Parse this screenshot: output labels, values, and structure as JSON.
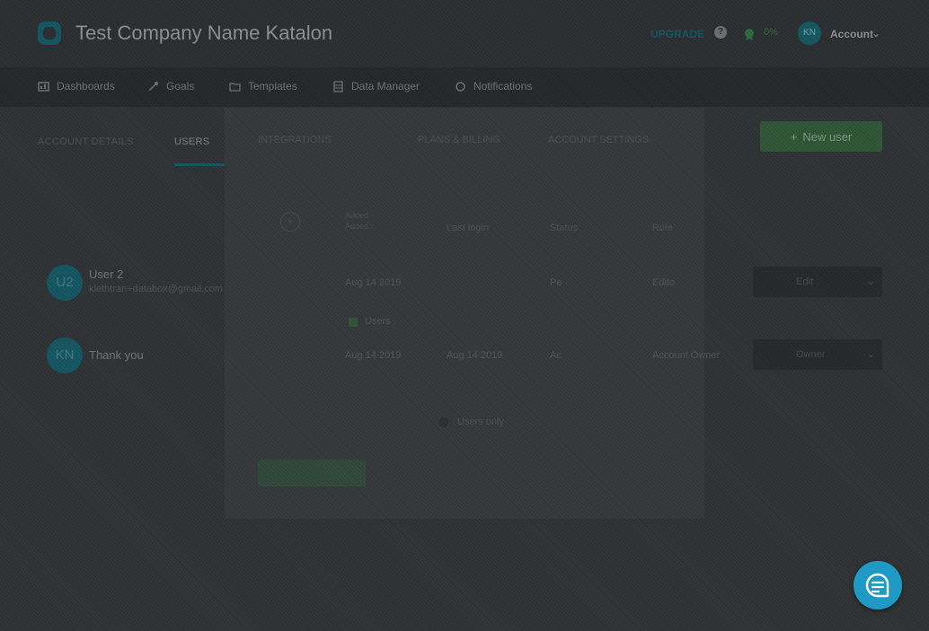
{
  "header": {
    "company": "Test Company Name Katalon",
    "upgrade": "UPGRADE",
    "badge_count": "0%",
    "avatar_initials": "KN",
    "account": "Account"
  },
  "nav": [
    {
      "label": "Dashboards",
      "icon": "dashboard-icon"
    },
    {
      "label": "Goals",
      "icon": "goals-icon"
    },
    {
      "label": "Templates",
      "icon": "folder-icon"
    },
    {
      "label": "Data Manager",
      "icon": "database-icon"
    },
    {
      "label": "Notifications",
      "icon": "bell-icon"
    }
  ],
  "tabs": {
    "account_details": "ACCOUNT DETAILS",
    "users": "USERS",
    "integrations": "INTEGRATIONS",
    "plans_billing": "PLANS & BILLING",
    "account_settings": "ACCOUNT SETTINGS"
  },
  "new_user": "New user",
  "table_headers": {
    "added": "Added",
    "last_login": "Last login",
    "status": "Status",
    "role": "Role",
    "mini_header": [
      "Added",
      "Added ↑"
    ]
  },
  "users": [
    {
      "initials": "U2",
      "name": "User 2",
      "email": "kiethtran+databox@gmail.com",
      "added": "Aug 14 2019",
      "status": "Pe",
      "role": "Edito",
      "select": "Edit"
    },
    {
      "initials": "KN",
      "name": "Thank you",
      "email": "",
      "added": "Aug 14 2019",
      "last_login": "Aug 14 2019",
      "status": "Ac",
      "role": "Account Owner",
      "select": "Owner"
    }
  ],
  "modal": {
    "checkbox_label": "Users",
    "radio_label": "Users only"
  },
  "colors": {
    "accent": "#145561",
    "green": "#2f5536",
    "chat": "#1f9ac4"
  }
}
